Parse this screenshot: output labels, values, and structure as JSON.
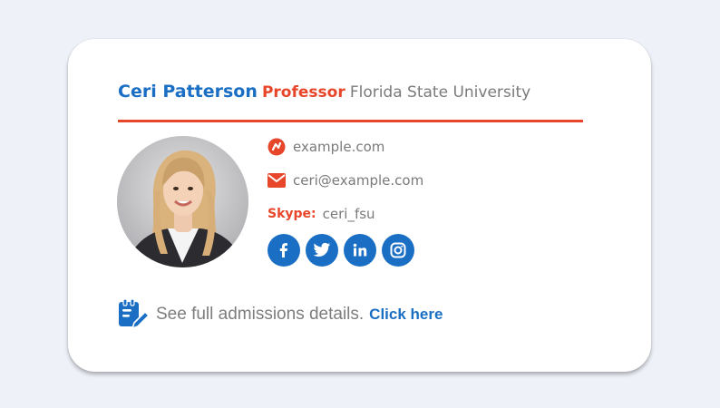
{
  "signature": {
    "name": "Ceri Patterson",
    "title": "Professor",
    "organization": "Florida State University",
    "website": "example.com",
    "email": "ceri@example.com",
    "skype_label": "Skype:",
    "skype_handle": "ceri_fsu"
  },
  "social": [
    {
      "icon": "facebook-icon",
      "label": "f"
    },
    {
      "icon": "twitter-icon",
      "label": ""
    },
    {
      "icon": "linkedin-icon",
      "label": "in"
    },
    {
      "icon": "instagram-icon",
      "label": ""
    }
  ],
  "footer": {
    "text": "See full admissions details.",
    "link_label": "Click here"
  },
  "colors": {
    "accent_blue": "#1a6fc4",
    "accent_red": "#e8462a",
    "text_gray": "#7a7a7a",
    "background": "#eef1f8"
  }
}
